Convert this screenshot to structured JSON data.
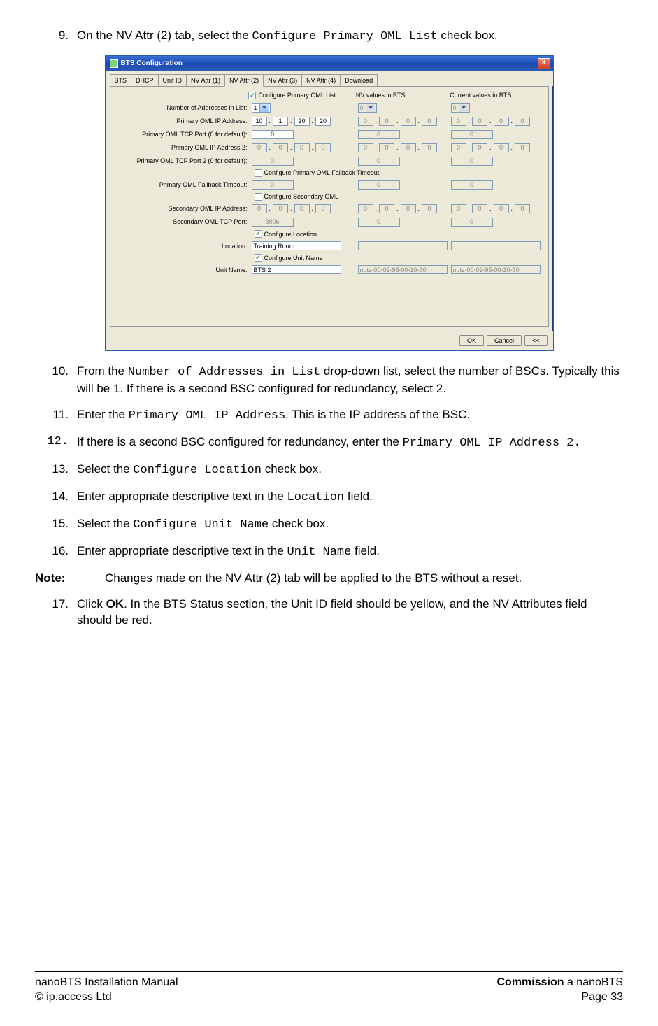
{
  "steps": {
    "s9": {
      "num": "9.",
      "pre": "On the NV Attr (2) tab, select the ",
      "code": "Configure Primary OML List",
      "post": " check box."
    },
    "s10": {
      "num": "10.",
      "pre": "From the ",
      "code": "Number of Addresses in List",
      "post": " drop-down list, select the number of BSCs. Typically this will be 1. If there is a second BSC configured for redundancy, select 2."
    },
    "s11": {
      "num": "11.",
      "pre": "Enter the ",
      "code": "Primary OML IP Address",
      "post": ". This is the IP address of the BSC."
    },
    "s12": {
      "num": "12.",
      "pre": "If there is a second BSC configured for redundancy, enter the ",
      "code": "Primary OML IP Address 2.",
      "post": ""
    },
    "s13": {
      "num": "13.",
      "pre": "Select the ",
      "code": "Configure Location",
      "post": " check box."
    },
    "s14": {
      "num": "14.",
      "pre": "Enter appropriate descriptive text in the ",
      "code": "Location",
      "post": " field."
    },
    "s15": {
      "num": "15.",
      "pre": "Select the ",
      "code": "Configure Unit Name",
      "post": " check box."
    },
    "s16": {
      "num": "16.",
      "pre": "Enter appropriate descriptive text in the ",
      "code": "Unit Name",
      "post": " field."
    },
    "s17": {
      "num": "17.",
      "pre": "Click ",
      "bold": "OK",
      "post": ". In the BTS Status section, the Unit ID field should be yellow, and the NV Attributes field should be red."
    }
  },
  "note": {
    "label": "Note:",
    "body": "Changes made on the NV Attr (2) tab will be applied to the BTS without a reset."
  },
  "dialog": {
    "title": "BTS Configuration",
    "close": "X",
    "tabs": [
      "BTS",
      "DHCP",
      "Unit ID",
      "NV Attr (1)",
      "NV Attr (2)",
      "NV Attr (3)",
      "NV Attr (4)",
      "Download"
    ],
    "active_tab": 4,
    "col_headers": {
      "nv": "NV values in BTS",
      "cur": "Current values in BTS"
    },
    "chk_primary": "Configure Primary OML List",
    "rows": {
      "num_addr": {
        "label": "Number of Addresses in List:",
        "val": "1",
        "nv": "0",
        "cur": "0"
      },
      "ip1": {
        "label": "Primary OML IP Address:",
        "a": "10",
        "b": "1",
        "c": "20",
        "d": "20",
        "nva": "0",
        "nvb": "0",
        "nvc": "0",
        "nvd": "0",
        "cua": "0",
        "cub": "0",
        "cuc": "0",
        "cud": "0"
      },
      "port1": {
        "label": "Primary OML TCP Port (0 for default):",
        "val": "0",
        "nv": "0",
        "cur": "0"
      },
      "ip2": {
        "label": "Primary OML IP Address 2:",
        "a": "0",
        "b": "0",
        "c": "0",
        "d": "0",
        "nva": "0",
        "nvb": "0",
        "nvc": "0",
        "nvd": "0",
        "cua": "0",
        "cub": "0",
        "cuc": "0",
        "cud": "0"
      },
      "port2": {
        "label": "Primary OML TCP Port 2 (0 for default):",
        "val": "0",
        "nv": "0",
        "cur": "0"
      },
      "chk_fallback": "Configure Primary OML Fallback Timeout",
      "fallback": {
        "label": "Primary OML Fallback Timeout:",
        "val": "0",
        "nv": "0",
        "cur": "0"
      },
      "chk_secondary": "Configure Secondary OML",
      "sip": {
        "label": "Secondary OML IP Address:",
        "a": "0",
        "b": "0",
        "c": "0",
        "d": "0",
        "nva": "0",
        "nvb": "0",
        "nvc": "0",
        "nvd": "0",
        "cua": "0",
        "cub": "0",
        "cuc": "0",
        "cud": "0"
      },
      "sport": {
        "label": "Secondary OML TCP Port:",
        "val": "3006",
        "nv": "0",
        "cur": "0"
      },
      "chk_loc": "Configure Location",
      "loc": {
        "label": "Location:",
        "val": "Training Room",
        "nv": "",
        "cur": ""
      },
      "chk_unit": "Configure Unit Name",
      "unit": {
        "label": "Unit Name:",
        "val": "BTS 2",
        "nv": "nbts-00-02-95-00-10-50",
        "cur": "nbts-00-02-95-00-10-50"
      }
    },
    "buttons": {
      "ok": "OK",
      "cancel": "Cancel",
      "back": "<<"
    }
  },
  "footer": {
    "left1": "nanoBTS Installation Manual",
    "left2": "© ip.access Ltd",
    "right1a": "Commission",
    "right1b": " a nanoBTS",
    "right2": "Page 33"
  }
}
